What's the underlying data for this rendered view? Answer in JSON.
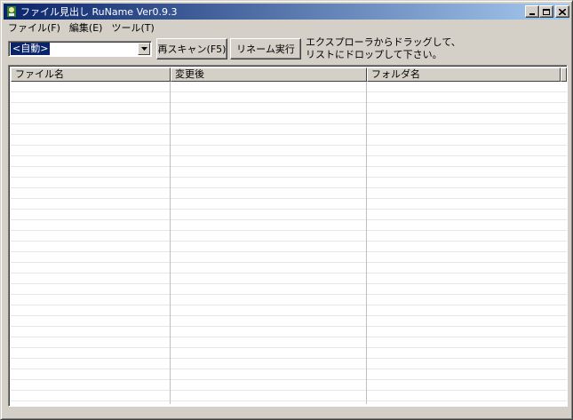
{
  "window": {
    "title": "ファイル見出し RuName Ver0.9.3",
    "controls": {
      "minimize": "_",
      "maximize": "□",
      "close": "×"
    }
  },
  "menu": [
    {
      "label": "ファイル(F)",
      "name": "menu-file"
    },
    {
      "label": "編集(E)",
      "name": "menu-edit"
    },
    {
      "label": "ツール(T)",
      "name": "menu-tools"
    }
  ],
  "toolbar": {
    "mode_select_value": "<自動>",
    "rescan_label": "再スキャン(F5)",
    "rename_label": "リネーム実行",
    "hint_line1": "エクスプローラからドラッグして、",
    "hint_line2": "リストにドロップして下さい。"
  },
  "list": {
    "columns": [
      "ファイル名",
      "変更後",
      "フォルダ名"
    ],
    "rows": []
  },
  "colors": {
    "titlebar_start": "#0a246a",
    "titlebar_end": "#a6caf0",
    "face": "#d4d0c8"
  }
}
